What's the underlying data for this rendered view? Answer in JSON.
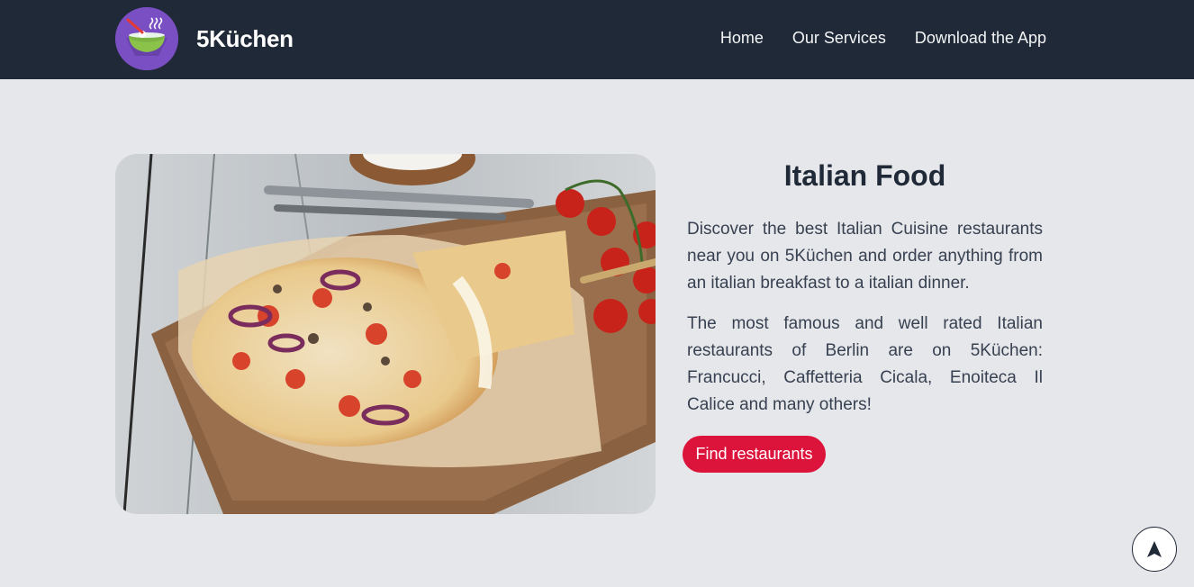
{
  "header": {
    "brand_name": "5Küchen",
    "logo_icon": "soup-bowl-icon",
    "nav": [
      {
        "label": "Home"
      },
      {
        "label": "Our Services"
      },
      {
        "label": "Download the App"
      }
    ]
  },
  "hero": {
    "image": "pizza-photo",
    "title": "Italian Food",
    "paragraphs": [
      "Discover the best Italian Cuisine restaurants near you on 5Küchen and order anything from an italian breakfast to a italian dinner.",
      "The most famous and well rated Italian restaurants of Berlin are on 5Küchen: Francucci, Caffetteria Cicala, Enoiteca Il Calice and many others!"
    ],
    "cta_label": "Find restaurants"
  },
  "scroll_top": {
    "icon": "arrow-up-icon"
  },
  "colors": {
    "navbar": "#1f2937",
    "background": "#e6e7ea",
    "accent": "#dc143c",
    "logo": "#7b4fc4"
  }
}
